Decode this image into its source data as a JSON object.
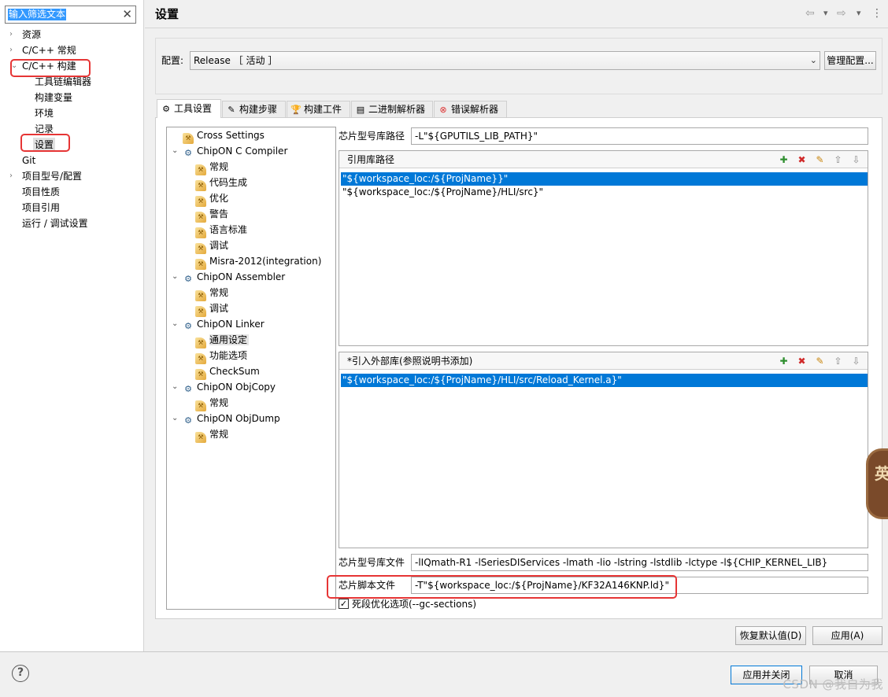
{
  "filter": {
    "value": "输入筛选文本",
    "clear": "✕"
  },
  "nav": {
    "items": [
      {
        "label": "资源",
        "expandable": true
      },
      {
        "label": "C/C++ 常规",
        "expandable": true
      },
      {
        "label": "C/C++ 构建",
        "expanded": true
      },
      {
        "label": "工具链编辑器"
      },
      {
        "label": "构建变量"
      },
      {
        "label": "环境"
      },
      {
        "label": "记录"
      },
      {
        "label": "设置",
        "selected": true
      },
      {
        "label": "Git"
      },
      {
        "label": "项目型号/配置",
        "expandable": true
      },
      {
        "label": "项目性质"
      },
      {
        "label": "项目引用"
      },
      {
        "label": "运行 / 调试设置"
      }
    ]
  },
  "page": {
    "title": "设置"
  },
  "header": {
    "back": "⇦",
    "back_menu": "▾",
    "forward": "⇨",
    "forward_menu": "▾",
    "more": "⋮"
  },
  "config": {
    "label": "配置:",
    "value": "Release ［ 活动 ］",
    "manage_label": "管理配置..."
  },
  "tabs": [
    {
      "label": "工具设置",
      "icon": "⚙",
      "active": true
    },
    {
      "label": "构建步骤",
      "icon": "✎"
    },
    {
      "label": "构建工件",
      "icon": "🏆"
    },
    {
      "label": "二进制解析器",
      "icon": "▤"
    },
    {
      "label": "错误解析器",
      "icon": "⊗"
    }
  ],
  "tool_tree": [
    {
      "label": "Cross Settings",
      "level": 0,
      "icon": "opt"
    },
    {
      "label": "ChipON C Compiler",
      "level": 0,
      "icon": "gear",
      "expanded": true
    },
    {
      "label": "常规",
      "level": 1,
      "icon": "opt"
    },
    {
      "label": "代码生成",
      "level": 1,
      "icon": "opt"
    },
    {
      "label": "优化",
      "level": 1,
      "icon": "opt"
    },
    {
      "label": "警告",
      "level": 1,
      "icon": "opt"
    },
    {
      "label": "语言标准",
      "level": 1,
      "icon": "opt"
    },
    {
      "label": "调试",
      "level": 1,
      "icon": "opt"
    },
    {
      "label": "Misra-2012(integration)",
      "level": 1,
      "icon": "opt"
    },
    {
      "label": "ChipON Assembler",
      "level": 0,
      "icon": "gear",
      "expanded": true
    },
    {
      "label": "常规",
      "level": 1,
      "icon": "opt"
    },
    {
      "label": "调试",
      "level": 1,
      "icon": "opt"
    },
    {
      "label": "ChipON Linker",
      "level": 0,
      "icon": "gear",
      "expanded": true
    },
    {
      "label": "通用设定",
      "level": 1,
      "icon": "opt",
      "selected": true
    },
    {
      "label": "功能选项",
      "level": 1,
      "icon": "opt"
    },
    {
      "label": "CheckSum",
      "level": 1,
      "icon": "opt"
    },
    {
      "label": "ChipON ObjCopy",
      "level": 0,
      "icon": "gear",
      "expanded": true
    },
    {
      "label": "常规",
      "level": 1,
      "icon": "opt"
    },
    {
      "label": "ChipON ObjDump",
      "level": 0,
      "icon": "gear",
      "expanded": true
    },
    {
      "label": "常规",
      "level": 1,
      "icon": "opt"
    }
  ],
  "linker": {
    "lib_path_label": "芯片型号库路径",
    "lib_path_value": "-L\"${GPUTILS_LIB_PATH}\"",
    "lib_dirs": {
      "title": "引用库路径",
      "rows": [
        {
          "text": "\"${workspace_loc:/${ProjName}}\"",
          "selected": true
        },
        {
          "text": "\"${workspace_loc:/${ProjName}/HLI/src}\"",
          "selected": false
        }
      ]
    },
    "ext_libs": {
      "title": "*引入外部库(参照说明书添加)",
      "rows": [
        {
          "text": "\"${workspace_loc:/${ProjName}/HLI/src/Reload_Kernel.a}\"",
          "selected": true
        }
      ]
    },
    "lib_file_label": "芯片型号库文件",
    "lib_file_value": "-lIQmath-R1 -lSeriesDIServices -lmath -lio -lstring -lstdlib -lctype -l${CHIP_KERNEL_LIB}",
    "script_label": "芯片脚本文件",
    "script_value": "-T\"${workspace_loc:/${ProjName}/KF32A146KNP.ld}\"",
    "deadcode_label": "死段优化选项(--gc-sections)",
    "deadcode_checked": true
  },
  "list_tools": {
    "add": "✚",
    "delete": "✖",
    "edit": "✎",
    "up": "⇧",
    "down": "⇩"
  },
  "buttons": {
    "restore": "恢复默认值(D)",
    "apply": "应用(A)",
    "apply_close": "应用并关闭",
    "cancel": "取消",
    "help": "?"
  },
  "watermark": "CSDN @我自为我",
  "side_widget": {
    "glyph": "英"
  },
  "colors": {
    "selection": "#0078d7",
    "highlight_box": "#e63535"
  }
}
